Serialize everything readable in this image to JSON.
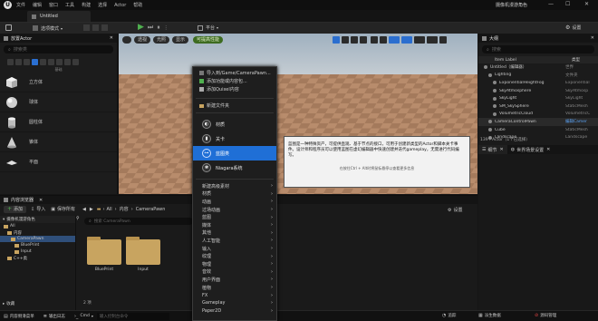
{
  "titlebar": {
    "menus": [
      "文件",
      "编辑",
      "窗口",
      "工具",
      "构建",
      "选择",
      "Actor",
      "帮助"
    ],
    "project": "摄像机漫游角色"
  },
  "tab": {
    "label": "Untitled"
  },
  "toolbar": {
    "mode": "选项模式",
    "platform": "平台",
    "settings": "设置"
  },
  "place_panel": {
    "title": "放置Actor",
    "search_placeholder": "搜索类",
    "section": "基础",
    "shapes": [
      "立方体",
      "球体",
      "圆柱体",
      "锥体",
      "平面"
    ]
  },
  "viewport": {
    "buttons": [
      "透视",
      "光照",
      "显示"
    ],
    "perf_badge": "可提高性能"
  },
  "outliner": {
    "title": "大纲",
    "search_placeholder": "搜索",
    "col_label": "Item Label",
    "col_type": "类型",
    "items": [
      {
        "label": "Untitled（编辑器）",
        "type": "世界",
        "indent": 0
      },
      {
        "label": "Lighting",
        "type": "文件夹",
        "indent": 1
      },
      {
        "label": "ExponentialHeightFog",
        "type": "Exponential",
        "indent": 2
      },
      {
        "label": "SkyAtmosphere",
        "type": "SkyAtmosp",
        "indent": 2
      },
      {
        "label": "SkyLight",
        "type": "SkyLight",
        "indent": 2
      },
      {
        "label": "SM_SkySphere",
        "type": "StaticMesh",
        "indent": 2
      },
      {
        "label": "VolumetricCloud",
        "type": "VolumetricC",
        "indent": 2
      },
      {
        "label": "CameraControlPawn",
        "type": "编辑Camer",
        "indent": 1
      },
      {
        "label": "Cube",
        "type": "StaticMesh",
        "indent": 1
      },
      {
        "label": "Landscape",
        "type": "Landscape",
        "indent": 1
      }
    ],
    "count": "139个Actor（1个已选择）"
  },
  "details": {
    "tab_details": "细节",
    "tab_world": "世界场景设置",
    "close": "关卡"
  },
  "content": {
    "title": "内容浏览器",
    "add": "添加",
    "import": "导入",
    "save_all": "保存所有",
    "breadcrumb": [
      "All",
      "内容",
      "CameraPawn"
    ],
    "settings": "设置",
    "search_placeholder": "搜索 CameraPawn",
    "tree_root": "摄像机漫游角色",
    "tree": [
      {
        "label": "All",
        "indent": 0
      },
      {
        "label": "内容",
        "indent": 1
      },
      {
        "label": "CameraPawn",
        "indent": 2
      },
      {
        "label": "BluePrint",
        "indent": 3
      },
      {
        "label": "Input",
        "indent": 3
      },
      {
        "label": "C++类",
        "indent": 1
      }
    ],
    "folders": [
      "BluePrint",
      "Input"
    ],
    "item_count": "2 项",
    "collections": "收藏"
  },
  "statusbar": {
    "drawer": "内容侧滑菜单",
    "output": "输出日志",
    "cmd": "Cmd",
    "cmd_placeholder": "输入控制台命令",
    "trace": "追踪",
    "derived": "派生数据",
    "source": "源码管理"
  },
  "context_menu": {
    "top_items": [
      "导入到/Game/CameraPawn...",
      "添加功能或内容包...",
      "添加Quixel内容"
    ],
    "new_folder": "新建文件夹",
    "big_items": [
      "材质",
      "关卡",
      "蓝图类",
      "Niagara系统"
    ],
    "selected_index": 2,
    "categories": [
      "新建高级素材",
      "材质",
      "动画",
      "过场动画",
      "蓝图",
      "媒体",
      "其他",
      "人工智能",
      "输入",
      "纹理",
      "物理",
      "音效",
      "用户界面",
      "植物",
      "FX",
      "Gameplay",
      "Paper2D"
    ]
  },
  "tooltip": {
    "text": "蓝图是一种特殊资产，可提供直观、基于节点的接口，可用于创建新类型的Actor和脚本关卡事件。设计师和程序员可以使用蓝图在虚幻编辑器中快速创建并迭代gameplay，无需进行代码编写。",
    "hint": "在按住Ctrl + Alt时将鼠标悬停以查看更多信息"
  }
}
